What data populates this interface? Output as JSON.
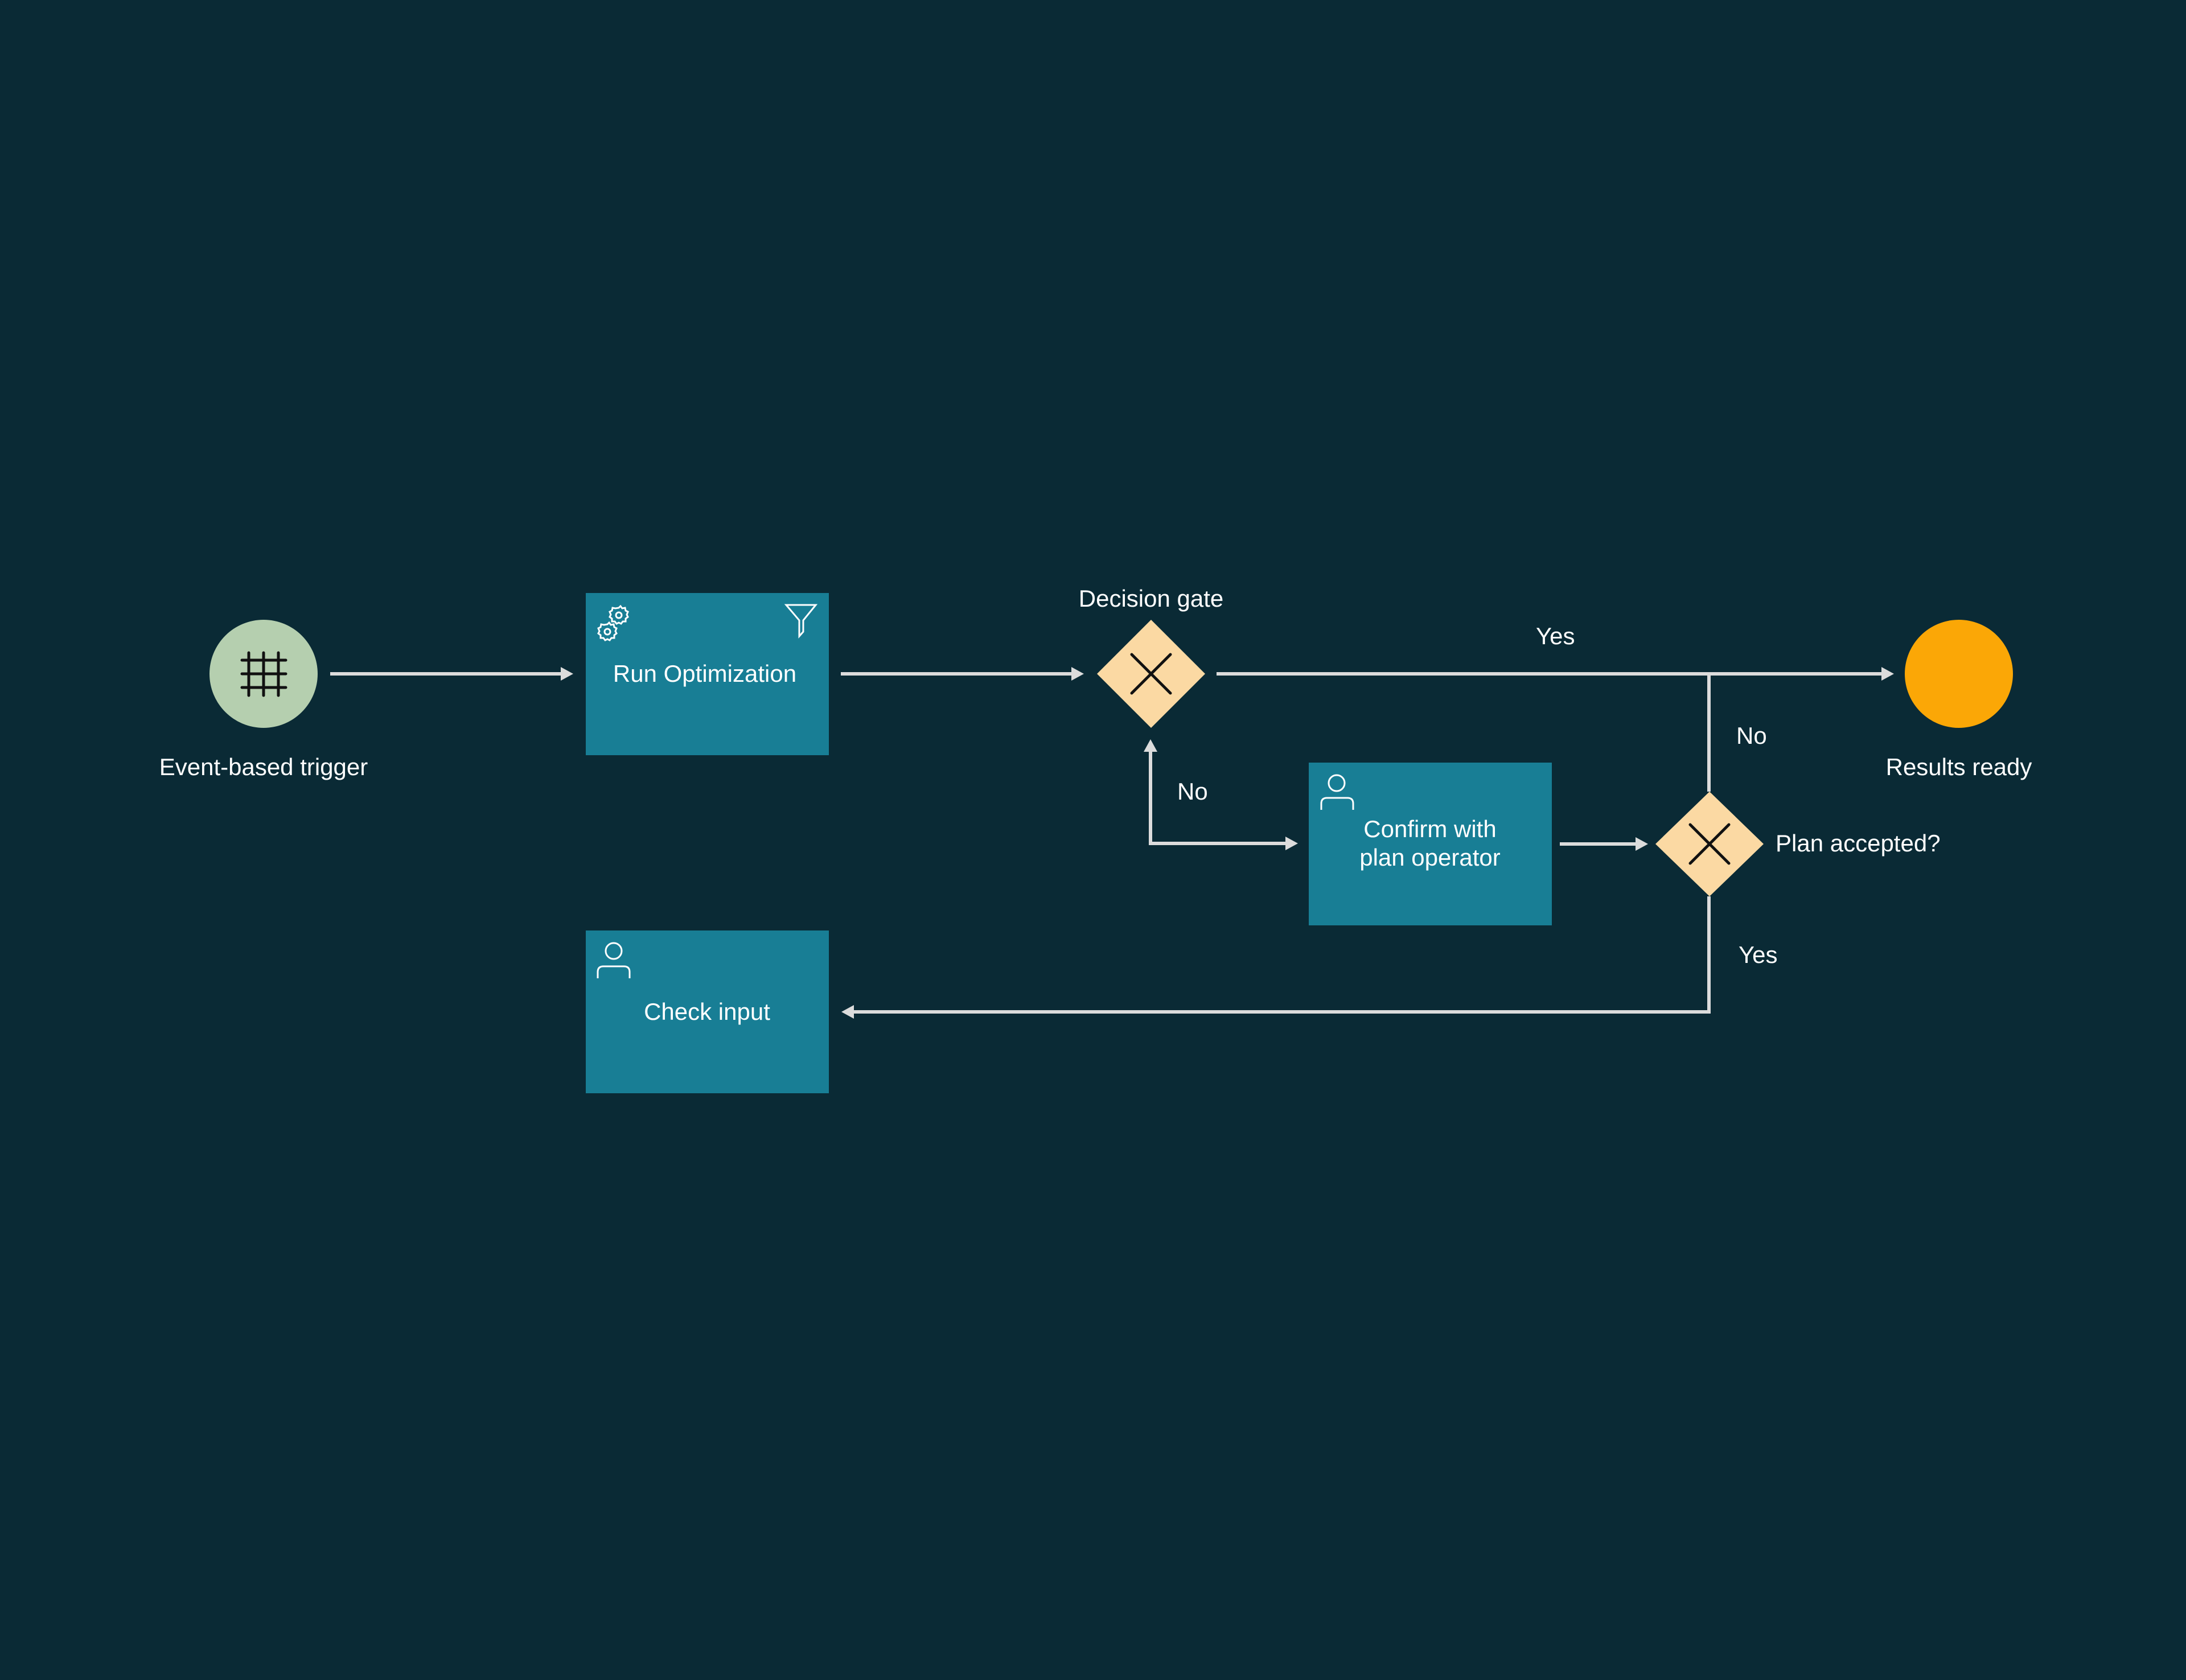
{
  "colors": {
    "background": "#0A2A35",
    "task": "#187E95",
    "gateway": "#FBD9A3",
    "start_event": "#B5CFAF",
    "end_event": "#FBA706",
    "flow": "#DCDCDC",
    "text": "#FFFFFF"
  },
  "nodes": {
    "start": {
      "type": "start-event",
      "icon": "grid-icon",
      "label": "Event-based trigger"
    },
    "run_optimization": {
      "type": "service-task",
      "icons": [
        "gears-icon",
        "funnel-icon"
      ],
      "label": "Run Optimization"
    },
    "decision_gate": {
      "type": "exclusive-gateway",
      "icon": "x-icon",
      "label": "Decision gate"
    },
    "confirm": {
      "type": "user-task",
      "icon": "person-icon",
      "label_line1": "Confirm with",
      "label_line2": "plan operator"
    },
    "plan_accepted": {
      "type": "exclusive-gateway",
      "icon": "x-icon",
      "label": "Plan accepted?"
    },
    "check_input": {
      "type": "user-task",
      "icon": "person-icon",
      "label": "Check input"
    },
    "end": {
      "type": "end-event",
      "label": "Results ready"
    }
  },
  "flows": [
    {
      "from": "start",
      "to": "run_optimization",
      "label": ""
    },
    {
      "from": "run_optimization",
      "to": "decision_gate",
      "label": ""
    },
    {
      "from": "decision_gate",
      "to": "end",
      "label": "Yes"
    },
    {
      "from": "decision_gate",
      "to": "confirm",
      "label": "No"
    },
    {
      "from": "confirm",
      "to": "plan_accepted",
      "label": ""
    },
    {
      "from": "plan_accepted",
      "to": "end",
      "label": "No"
    },
    {
      "from": "plan_accepted",
      "to": "check_input",
      "label": "Yes"
    }
  ],
  "flow_labels": {
    "gate_yes": "Yes",
    "gate_no": "No",
    "plan_no": "No",
    "plan_yes": "Yes"
  }
}
